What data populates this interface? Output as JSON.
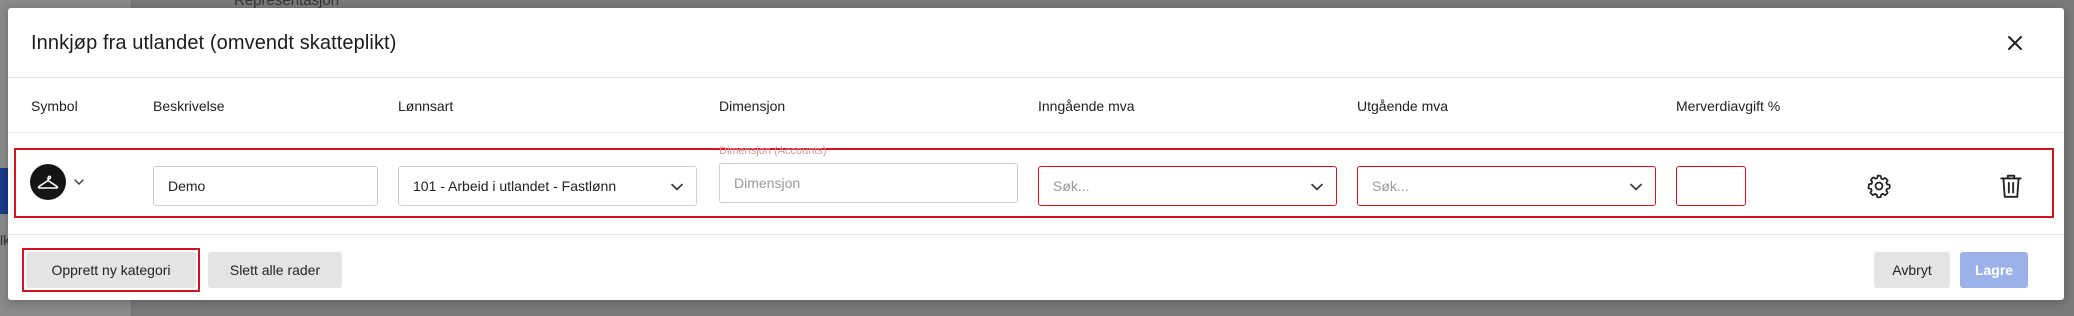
{
  "background": {
    "heading": "Representasjon",
    "side_text": "lk"
  },
  "modal": {
    "title": "Innkjøp fra utlandet (omvendt skatteplikt)",
    "close_icon": "close-icon"
  },
  "columns": {
    "symbol": "Symbol",
    "description": "Beskrivelse",
    "wage_type": "Lønnsart",
    "dimension": "Dimensjon",
    "input_vat": "Inngående mva",
    "output_vat": "Utgående mva",
    "vat_percent": "Merverdiavgift %"
  },
  "row": {
    "symbol_icon": "hanger-icon",
    "description_value": "Demo",
    "wage_type_value": "101 - Arbeid i utlandet - Fastlønn",
    "dimension_label": "Dimensjon (Accounts)",
    "dimension_placeholder": "Dimensjon",
    "input_vat_placeholder": "Søk...",
    "output_vat_placeholder": "Søk...",
    "vat_percent_value": "",
    "settings_icon": "gear-icon",
    "delete_icon": "trash-icon"
  },
  "footer": {
    "create_category": "Opprett ny kategori",
    "delete_all_rows": "Slett alle rader",
    "cancel": "Avbryt",
    "save": "Lagre"
  },
  "colors": {
    "error": "#d0141e",
    "save_disabled": "#9bb1e8",
    "button_gray": "#e4e4e4"
  }
}
